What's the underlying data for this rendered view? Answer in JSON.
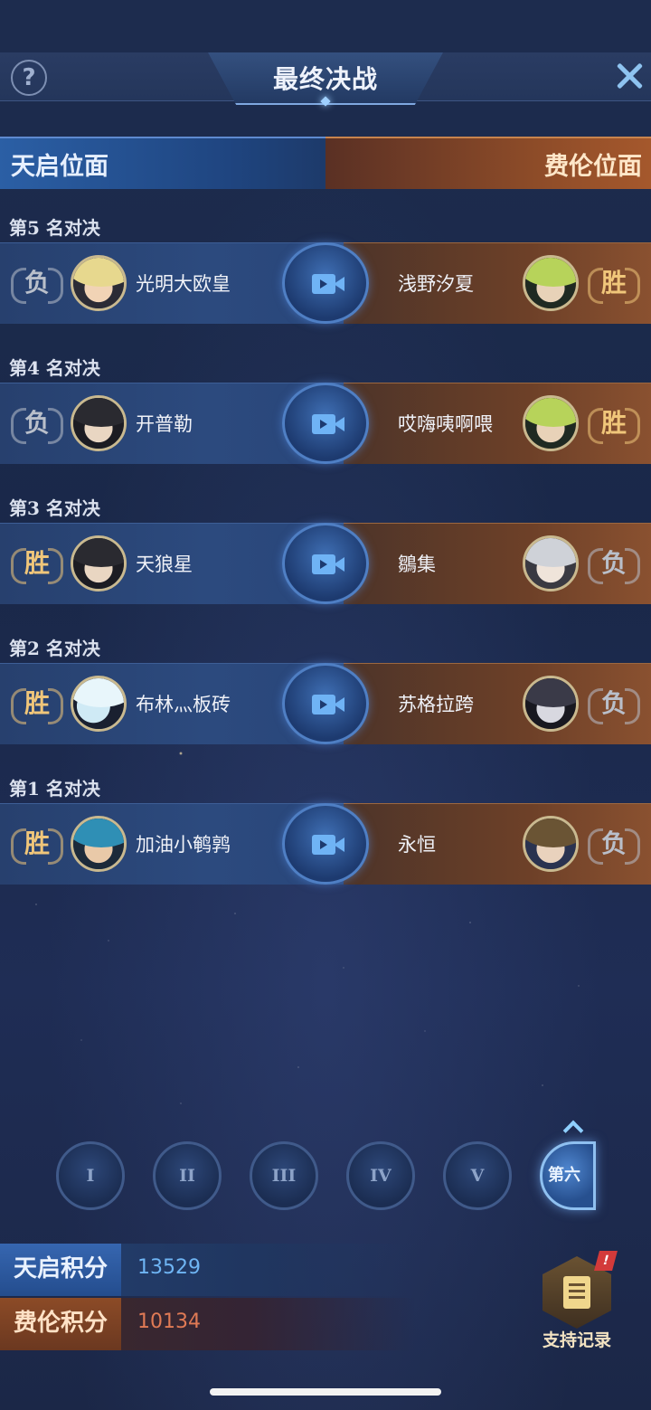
{
  "header": {
    "title": "最终决战",
    "help_glyph": "?"
  },
  "factions": {
    "left": "天启位面",
    "right": "费伦位面",
    "colors": {
      "left": "#2b5fa5",
      "right": "#8a4a28"
    }
  },
  "matches": [
    {
      "label": "第5 名对决",
      "left_result": "负",
      "left_name": "光明大欧皇",
      "right_name": "浅野汐夏",
      "right_result": "胜"
    },
    {
      "label": "第4 名对决",
      "left_result": "负",
      "left_name": "开普勒",
      "right_name": "哎嗨咦啊喂",
      "right_result": "胜"
    },
    {
      "label": "第3 名对决",
      "left_result": "胜",
      "left_name": "天狼星",
      "right_name": "鶵集",
      "right_result": "负"
    },
    {
      "label": "第2 名对决",
      "left_result": "胜",
      "left_name": "布林灬板砖",
      "right_name": "苏格拉跨",
      "right_result": "负"
    },
    {
      "label": "第1 名对决",
      "left_result": "胜",
      "left_name": "加油小鹌鹑",
      "right_name": "永恒",
      "right_result": "负"
    }
  ],
  "rounds": [
    "I",
    "II",
    "III",
    "IV",
    "V",
    "第六天"
  ],
  "active_round": "第六天",
  "scores": {
    "tianqi_label": "天启积分",
    "tianqi_value": "13529",
    "feilun_label": "费伦积分",
    "feilun_value": "10134"
  },
  "support": {
    "label": "支持记录",
    "badge": "!"
  },
  "icons": {
    "help": "question-icon",
    "close": "close-icon",
    "replay": "video-camera-icon",
    "support": "document-icon"
  }
}
